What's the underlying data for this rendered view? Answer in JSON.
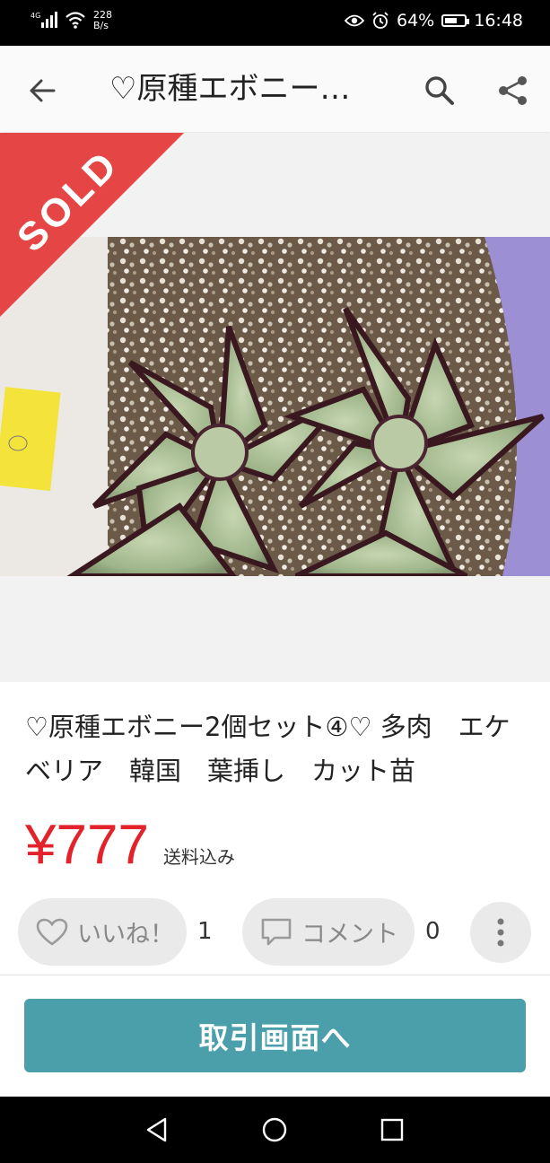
{
  "status_bar": {
    "network": "4G",
    "speed_value": "228",
    "speed_unit": "B/s",
    "battery": "64%",
    "time": "16:48",
    "battery_level": 0.64
  },
  "app_bar": {
    "title": "♡原種エボニー…",
    "back_icon": "arrow-left-icon",
    "search_icon": "search-icon",
    "share_icon": "share-icon"
  },
  "item": {
    "sold_label": "SOLD",
    "title": "♡原種エボニー2個セット④♡ 多肉　エケベリア　韓国　葉挿し　カット苗",
    "price": "¥777",
    "shipping": "送料込み",
    "like_label": "いいね！",
    "like_count": "1",
    "comment_label": "コメント",
    "comment_count": "0"
  },
  "actions": {
    "trade_button": "取引画面へ"
  },
  "colors": {
    "price": "#e3232b",
    "sold_banner": "#e64545",
    "trade_button": "#4a9faa"
  }
}
